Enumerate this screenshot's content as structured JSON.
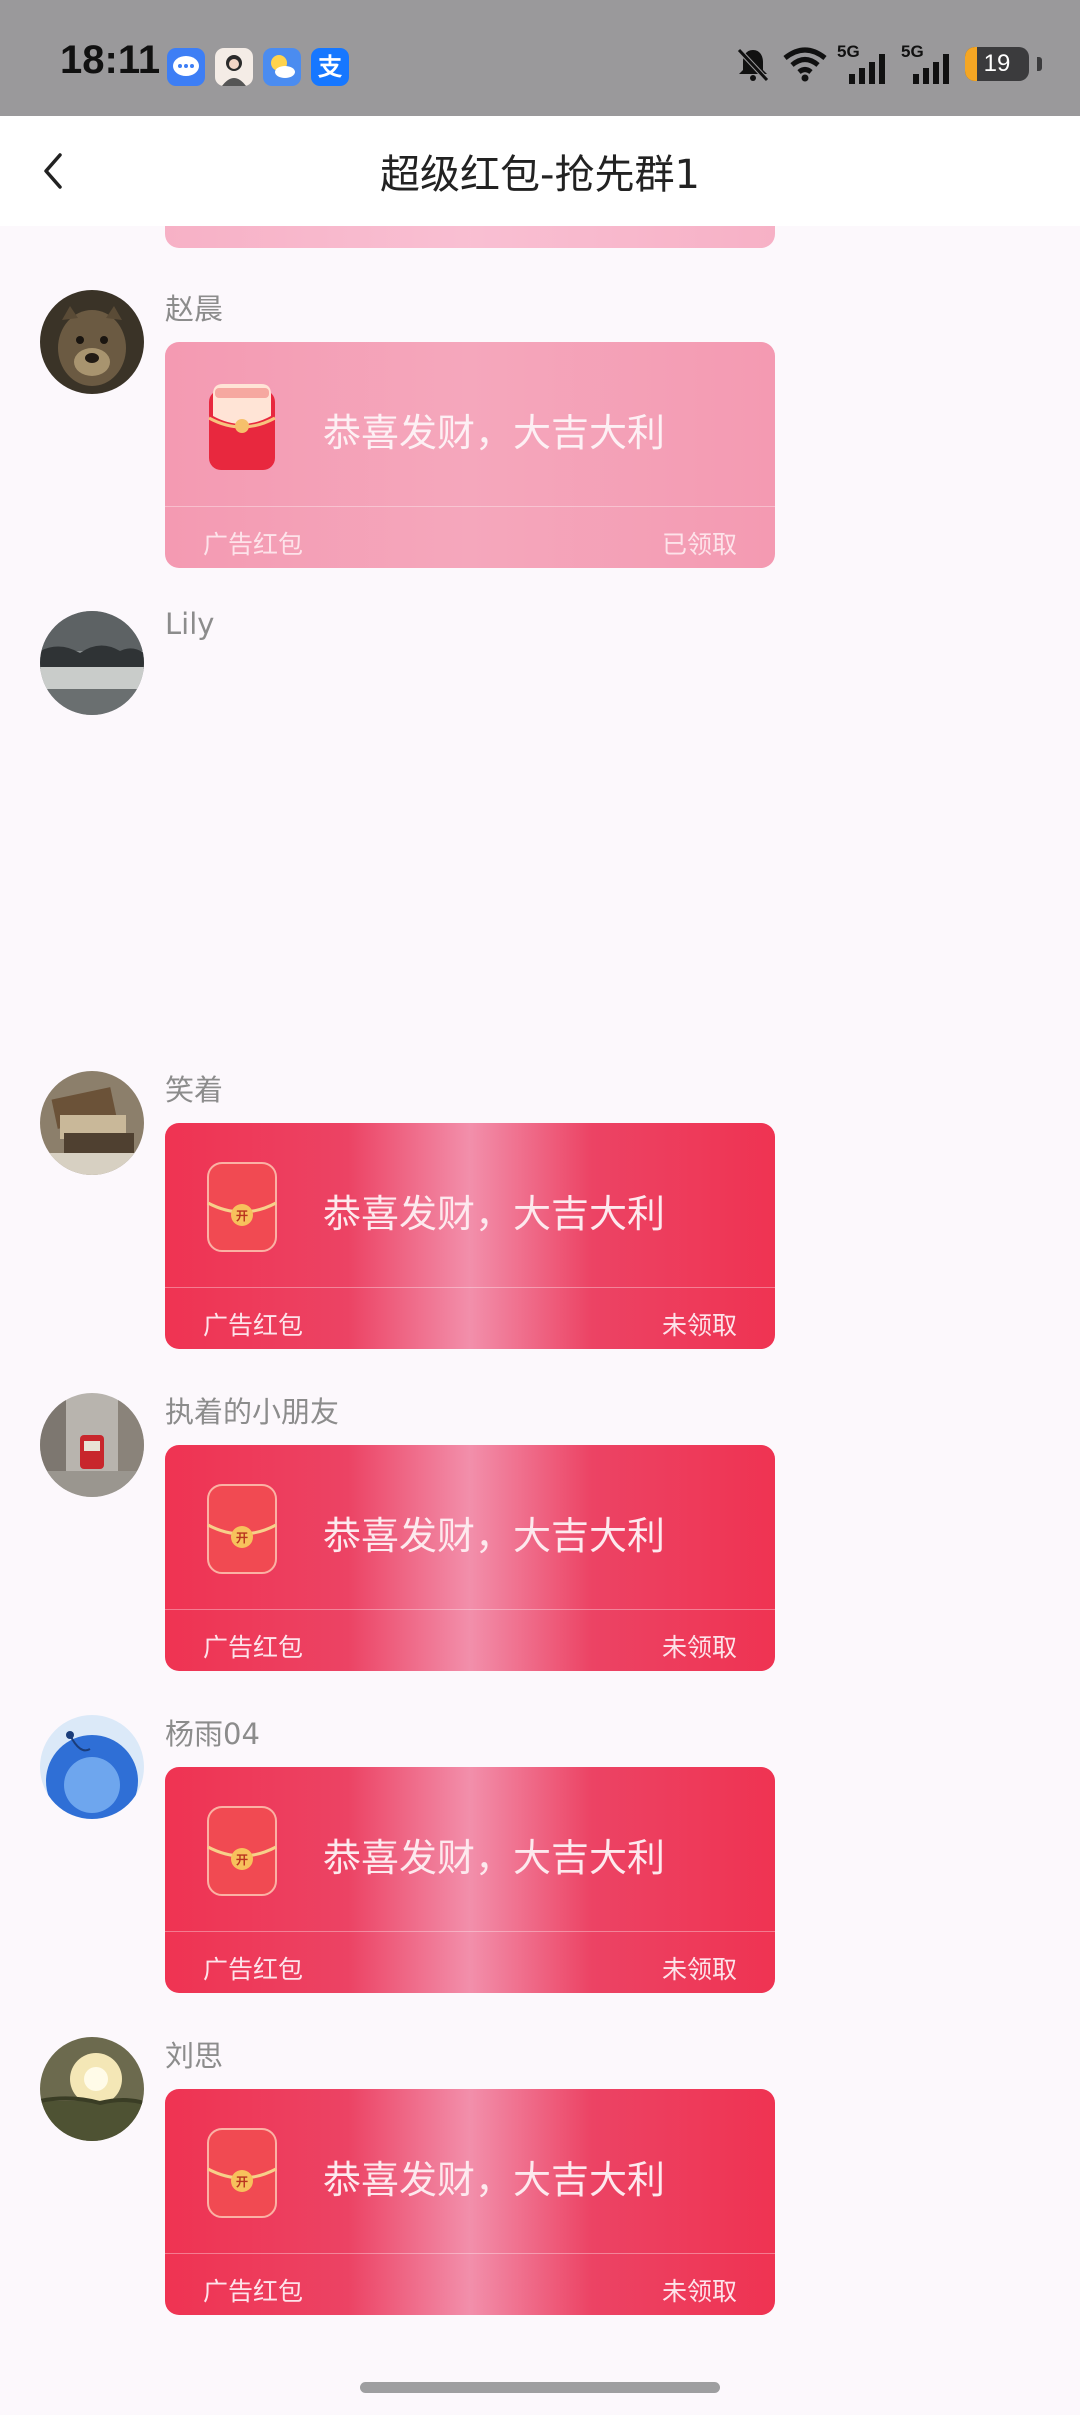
{
  "status_bar": {
    "time": "18:11",
    "app_icons": [
      {
        "name": "messages-icon",
        "color": "#3d7ef5",
        "glyph": "…"
      },
      {
        "name": "profile-photo-icon",
        "color": "#e8dcd2",
        "glyph": ""
      },
      {
        "name": "weather-icon",
        "color": "#4b8cf0",
        "glyph": "☀"
      },
      {
        "name": "alipay-icon",
        "color": "#1677ff",
        "glyph": "支"
      }
    ],
    "network_1": "5G",
    "network_2": "5G",
    "battery": "19",
    "battery_level": 0.19,
    "colors": {
      "background": "#9a999b",
      "battery_fill": "#f5a623"
    }
  },
  "header": {
    "title": "超级红包-抢先群1"
  },
  "messages": [
    {
      "sender": "赵晨",
      "avatar_icon": "tiger-avatar",
      "card": {
        "greeting": "恭喜发财，大吉大利",
        "type": "广告红包",
        "status": "已领取",
        "state": "claimed"
      }
    },
    {
      "sender": "Lily",
      "avatar_icon": "misty-landscape-avatar"
    },
    {
      "sender": "笑着",
      "avatar_icon": "books-avatar",
      "card": {
        "greeting": "恭喜发财，大吉大利",
        "type": "广告红包",
        "status": "未领取",
        "state": "unopened"
      }
    },
    {
      "sender": "执着的小朋友",
      "avatar_icon": "street-tram-avatar",
      "card": {
        "greeting": "恭喜发财，大吉大利",
        "type": "广告红包",
        "status": "未领取",
        "state": "unopened"
      }
    },
    {
      "sender": "杨雨04",
      "avatar_icon": "blue-flower-avatar",
      "card": {
        "greeting": "恭喜发财，大吉大利",
        "type": "广告红包",
        "status": "未领取",
        "state": "unopened"
      }
    },
    {
      "sender": "刘思",
      "avatar_icon": "sunset-field-avatar",
      "card": {
        "greeting": "恭喜发财，大吉大利",
        "type": "广告红包",
        "status": "未领取",
        "state": "unopened"
      }
    }
  ],
  "envelope_open_glyph": "开",
  "colors": {
    "unopened_card": "#ef3352",
    "claimed_card": "#f49ab2",
    "chat_background": "#fcf8fc"
  }
}
